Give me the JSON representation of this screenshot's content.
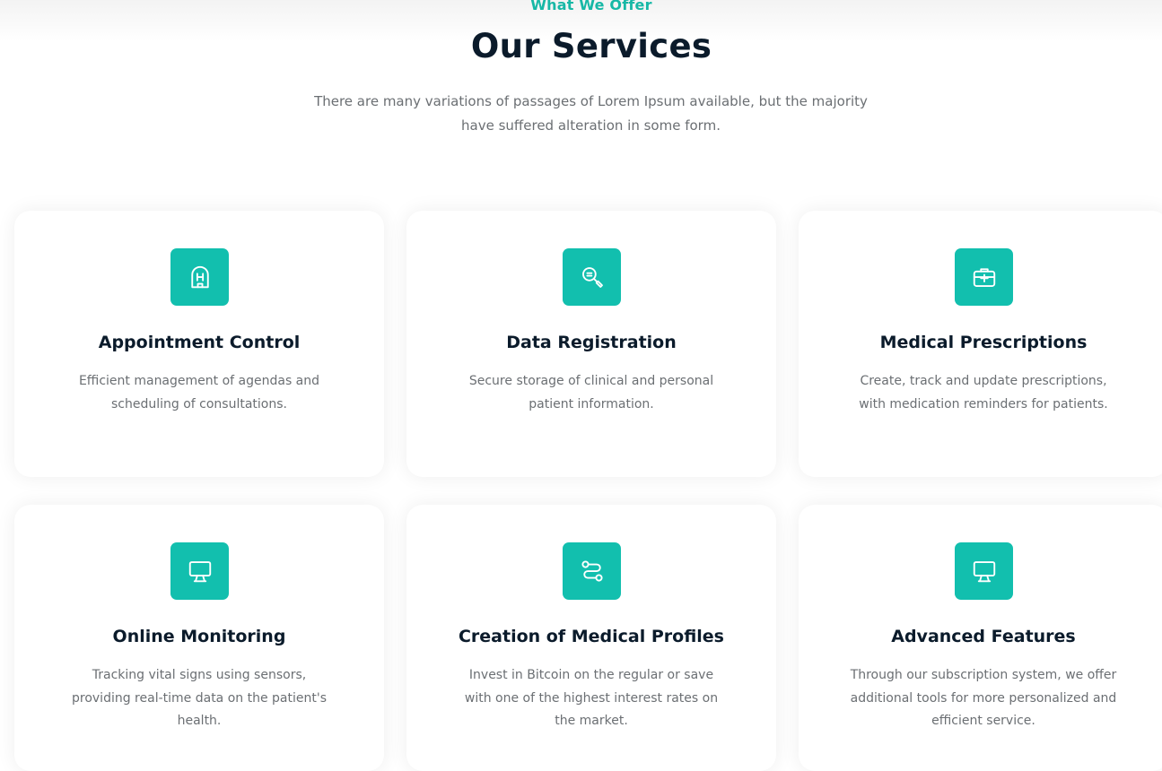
{
  "header": {
    "eyebrow": "What We Offer",
    "title": "Our Services",
    "subtitle": "There are many variations of passages of Lorem Ipsum available, but the majority have suffered alteration in some form."
  },
  "accent_color": "#12bfae",
  "services": [
    {
      "icon": "hospital-icon",
      "title": "Appointment Control",
      "text": "Efficient management of agendas and scheduling of consultations."
    },
    {
      "icon": "magnifier-icon",
      "title": "Data Registration",
      "text": "Secure storage of clinical and personal patient information."
    },
    {
      "icon": "medical-kit-icon",
      "title": "Medical Prescriptions",
      "text": "Create, track and update prescriptions, with medication reminders for patients."
    },
    {
      "icon": "monitor-icon",
      "title": "Online Monitoring",
      "text": "Tracking vital signs using sensors, providing real-time data on the patient's health."
    },
    {
      "icon": "route-icon",
      "title": "Creation of Medical Profiles",
      "text": "Invest in Bitcoin on the regular or save with one of the highest interest rates on the market."
    },
    {
      "icon": "monitor-icon",
      "title": "Advanced Features",
      "text": "Through our subscription system, we offer additional tools for more personalized and efficient service."
    }
  ]
}
